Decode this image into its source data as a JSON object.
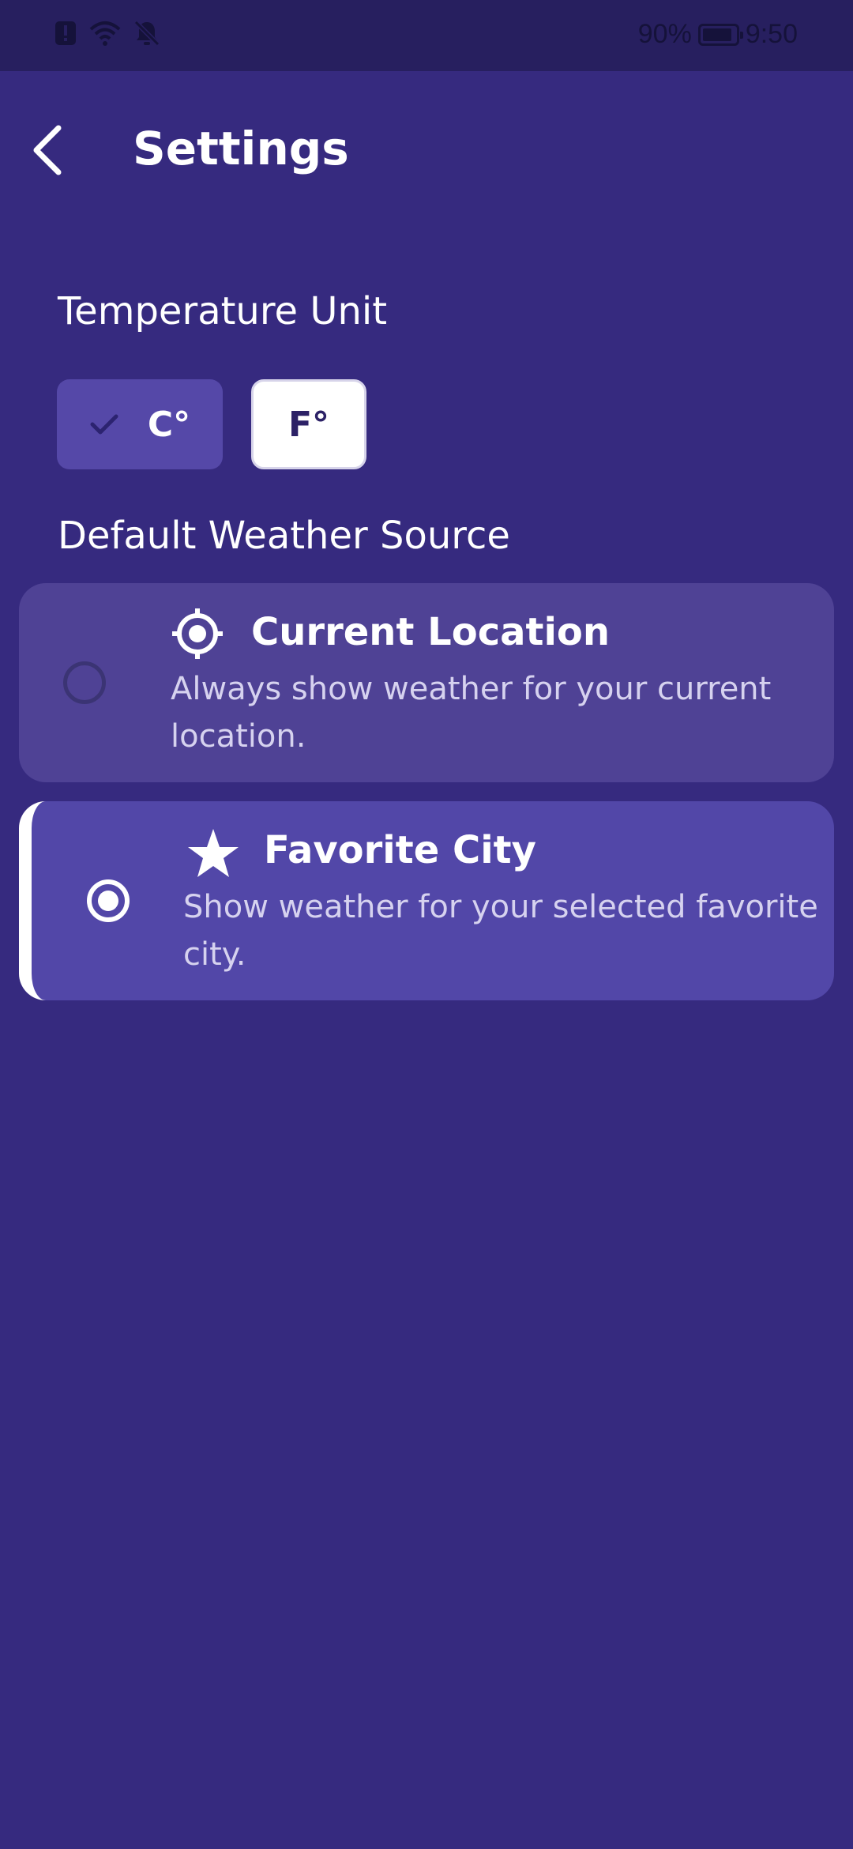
{
  "status_bar": {
    "battery_percent": "90%",
    "battery_level": 0.9,
    "time": "9:50",
    "icons": [
      "alert-icon",
      "wifi-icon",
      "notifications-off-icon",
      "battery-charging-icon"
    ]
  },
  "header": {
    "back_icon": "chevron-left-icon",
    "title": "Settings"
  },
  "temperature_unit": {
    "label": "Temperature Unit",
    "options": [
      {
        "label": "C°",
        "selected": true,
        "icon": "check-icon"
      },
      {
        "label": "F°",
        "selected": false
      }
    ]
  },
  "weather_source": {
    "label": "Default Weather Source",
    "options": [
      {
        "title": "Current Location",
        "description": "Always show weather for your current location.",
        "icon": "location-target-icon",
        "selected": false
      },
      {
        "title": "Favorite City",
        "description": "Show weather for your selected favorite city.",
        "icon": "star-icon",
        "selected": true
      }
    ]
  },
  "colors": {
    "background": "#362a7f",
    "status_bar": "#271f5f",
    "card_unselected": "#4f4295",
    "card_selected": "#5247a8",
    "accent": "#ffffff"
  }
}
